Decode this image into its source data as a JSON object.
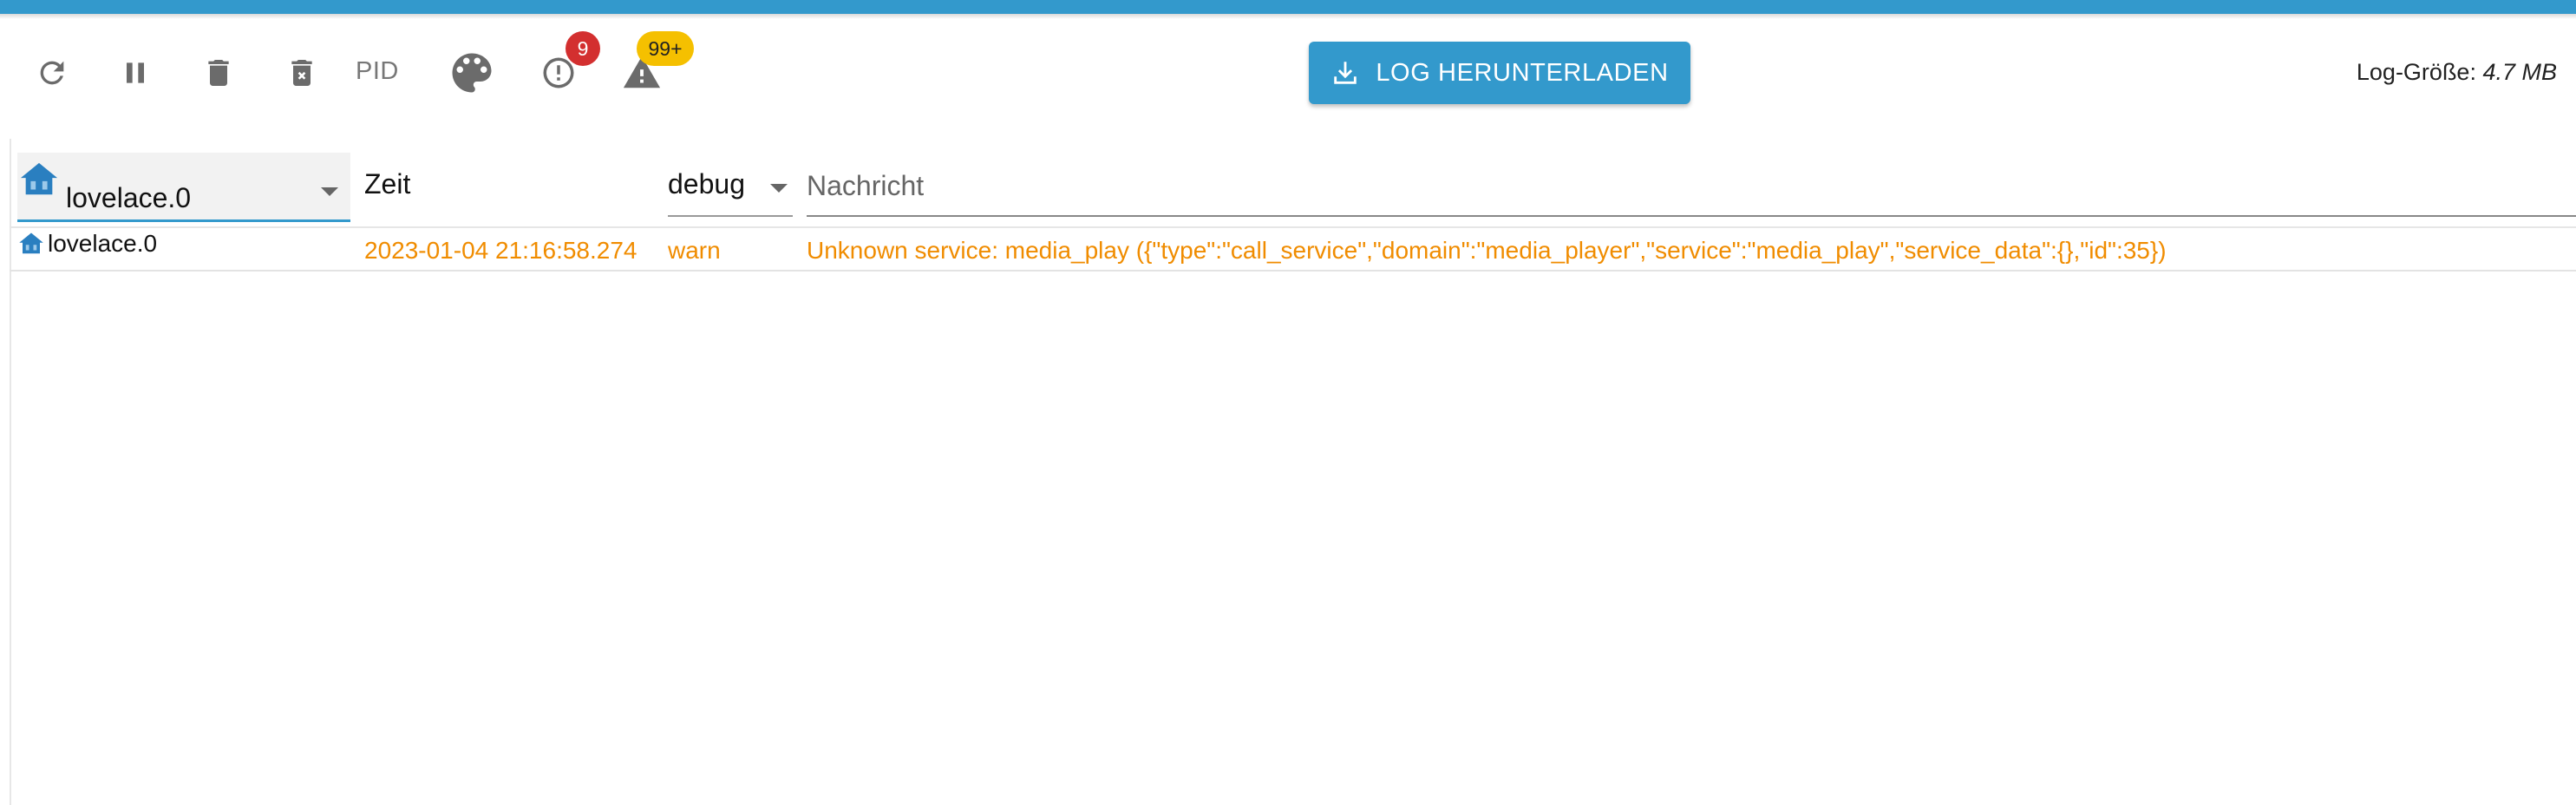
{
  "toolbar": {
    "pid_label": "PID",
    "errors_badge": "9",
    "warnings_badge": "99+",
    "download_label": "LOG HERUNTERLADEN",
    "log_size_label": "Log-Größe: ",
    "log_size_value": "4.7 MB"
  },
  "filters": {
    "source_value": "lovelace.0",
    "time_header": "Zeit",
    "level_value": "debug",
    "message_placeholder": "Nachricht"
  },
  "log_rows": [
    {
      "source": "lovelace.0",
      "time": "2023-01-04 21:16:58.274",
      "level": "warn",
      "message": "Unknown service: media_play ({\"type\":\"call_service\",\"domain\":\"media_player\",\"service\":\"media_play\",\"service_data\":{},\"id\":35})"
    }
  ],
  "colors": {
    "accent": "#3399cc",
    "warn_text": "#f08c00",
    "error_badge": "#d32f2f",
    "warning_badge": "#f5c000"
  }
}
